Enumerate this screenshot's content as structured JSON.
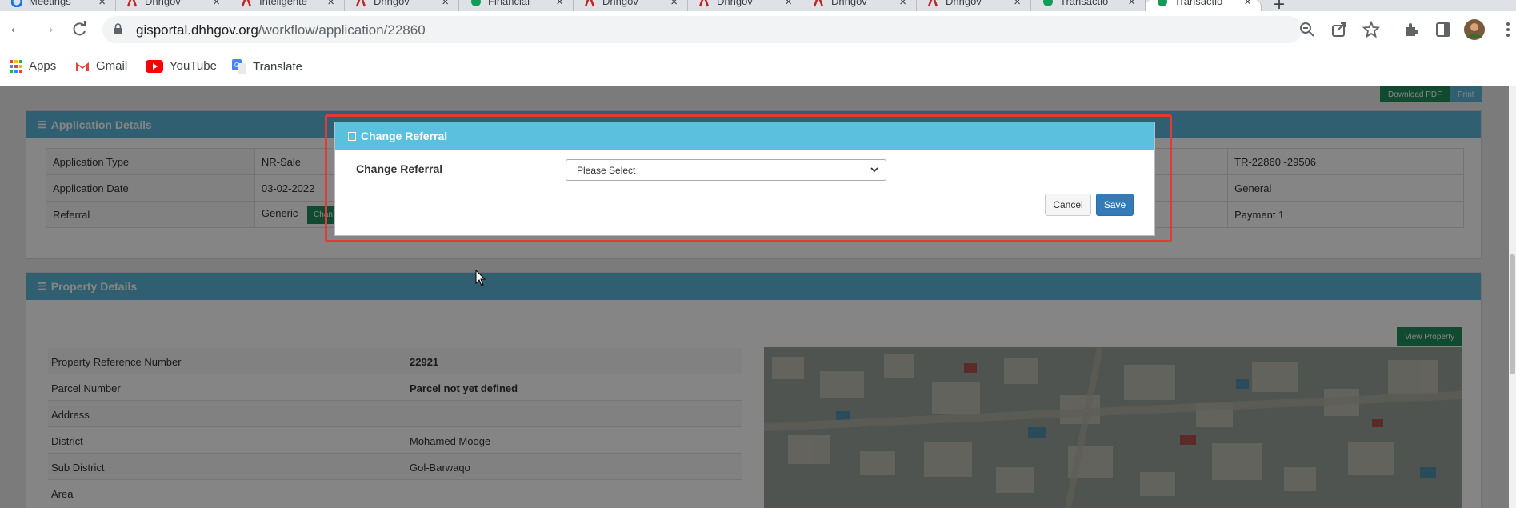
{
  "tabs": [
    {
      "label": "Meetings",
      "favicon": "google-icon",
      "color": "#1a73e8"
    },
    {
      "label": "Dhhgov",
      "favicon": "dhhgov-icon",
      "color": "#c5221f"
    },
    {
      "label": "Inteligente",
      "favicon": "dhhgov-icon",
      "color": "#c5221f"
    },
    {
      "label": "Dhhgov",
      "favicon": "dhhgov-icon",
      "color": "#c5221f"
    },
    {
      "label": "Financial",
      "favicon": "green-circle-icon",
      "color": "#0f9d58"
    },
    {
      "label": "Dhhgov",
      "favicon": "dhhgov-icon",
      "color": "#c5221f"
    },
    {
      "label": "Dhhgov",
      "favicon": "dhhgov-icon",
      "color": "#c5221f"
    },
    {
      "label": "Dhhgov",
      "favicon": "dhhgov-icon",
      "color": "#c5221f"
    },
    {
      "label": "Dhhgov",
      "favicon": "dhhgov-icon",
      "color": "#c5221f"
    },
    {
      "label": "Transactio",
      "favicon": "green-circle-icon",
      "color": "#0f9d58"
    },
    {
      "label": "Transactio",
      "favicon": "green-circle-icon",
      "color": "#0f9d58"
    }
  ],
  "toolbar": {
    "url_host": "gisportal.dhhgov.org",
    "url_path": "/workflow/application/22860"
  },
  "bookmarks": [
    {
      "label": "Apps",
      "icon": "apps-grid-icon"
    },
    {
      "label": "Gmail",
      "icon": "gmail-icon"
    },
    {
      "label": "YouTube",
      "icon": "youtube-icon"
    },
    {
      "label": "Translate",
      "icon": "translate-icon"
    }
  ],
  "page": {
    "download_pdf": "Download PDF",
    "print": "Print",
    "application_details": {
      "title": "Application Details",
      "rows": [
        {
          "label": "Application Type",
          "value": "NR-Sale",
          "right_value": "TR-22860 -29506"
        },
        {
          "label": "Application Date",
          "value": "03-02-2022",
          "right_value": "General"
        },
        {
          "label": "Referral",
          "value": "Generic",
          "button": "Chan",
          "right_value": "Payment 1"
        }
      ]
    },
    "property_details": {
      "title": "Property Details",
      "view_property": "View Property",
      "rows": [
        {
          "label": "Property Reference Number",
          "value": "22921",
          "bold": true
        },
        {
          "label": "Parcel Number",
          "value": "Parcel not yet defined",
          "bold": true
        },
        {
          "label": "Address",
          "value": "",
          "bold": false
        },
        {
          "label": "District",
          "value": "Mohamed Mooge",
          "bold": false
        },
        {
          "label": "Sub District",
          "value": "Gol-Barwaqo",
          "bold": false
        },
        {
          "label": "Area",
          "value": "",
          "bold": false
        }
      ]
    }
  },
  "modal": {
    "title": "Change Referral",
    "field_label": "Change Referral",
    "select_value": "Please Select",
    "cancel": "Cancel",
    "save": "Save"
  },
  "colors": {
    "panel_header": "#5bb7d6",
    "green_button": "#1e8f5f",
    "save_button": "#337ab7",
    "highlight": "#e53935"
  }
}
